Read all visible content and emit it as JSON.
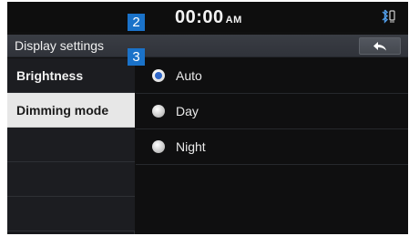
{
  "status_bar": {
    "time": "00:00",
    "ampm": "AM",
    "icon": "bluetooth-phone-icon"
  },
  "header": {
    "title": "Display settings",
    "back_icon": "back-arrow-icon"
  },
  "sidebar": {
    "items": [
      {
        "label": "Brightness",
        "selected": false
      },
      {
        "label": "Dimming mode",
        "selected": true
      }
    ]
  },
  "options": [
    {
      "label": "Auto",
      "checked": true
    },
    {
      "label": "Day",
      "checked": false
    },
    {
      "label": "Night",
      "checked": false
    }
  ],
  "callouts": [
    "2",
    "3"
  ],
  "colors": {
    "accent": "#1a72c9",
    "radio_selected": "#2f67c9",
    "background": "#101010"
  }
}
